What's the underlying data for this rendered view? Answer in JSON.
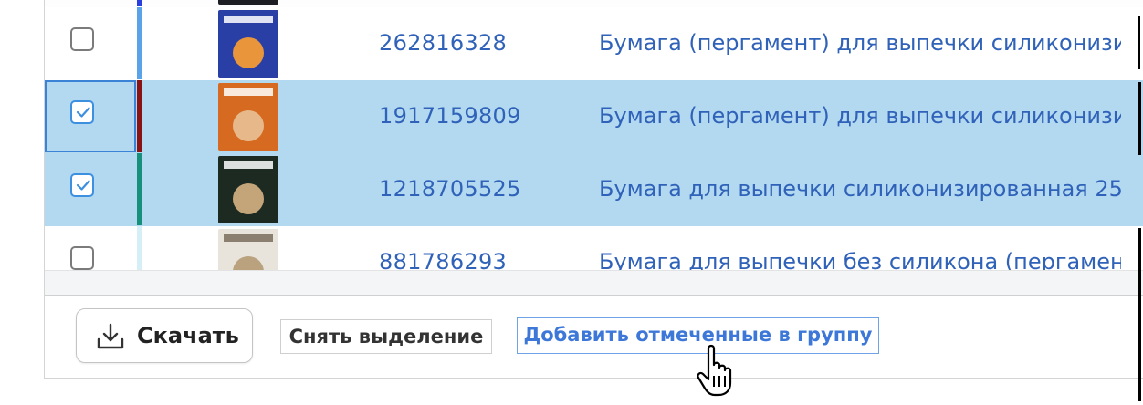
{
  "rows": [
    {
      "id": "top",
      "sku": "",
      "title": "",
      "checked": false,
      "accent": "#2a3ee0"
    },
    {
      "id": "r1",
      "sku": "262816328",
      "title": "Бумага (пергамент) для выпечки силиконизи",
      "checked": false,
      "accent": "#5aa3ea"
    },
    {
      "id": "r2",
      "sku": "1917159809",
      "title": "Бумага (пергамент) для выпечки силиконизи",
      "checked": true,
      "accent": "#8a1212"
    },
    {
      "id": "r3",
      "sku": "1218705525",
      "title": "Бумага для выпечки силиконизированная 25",
      "checked": true,
      "accent": "#178f7a"
    },
    {
      "id": "r4",
      "sku": "881786293",
      "title": "Бумага для выпечки без силикона (пергамен",
      "checked": false,
      "accent": "#d6eef6"
    }
  ],
  "thumb_colors": {
    "r1": [
      "#2a3fa6",
      "#e8953b"
    ],
    "r2": [
      "#d66a20",
      "#e7b98a"
    ],
    "r3": [
      "#1c2a22",
      "#c4a57a"
    ],
    "r4": [
      "#e8e4dc",
      "#b9a27d"
    ]
  },
  "footer": {
    "download_label": "Скачать",
    "clear_selection_label": "Снять выделение",
    "add_to_group_label": "Добавить отмеченные в группу"
  },
  "colors": {
    "selected_row": "#b3d9f1",
    "link": "#2f62b8",
    "checkbox_accent": "#3d8fe0"
  },
  "icons": [
    "checkbox-checked-icon",
    "download-icon",
    "hand-pointer-cursor-icon"
  ]
}
